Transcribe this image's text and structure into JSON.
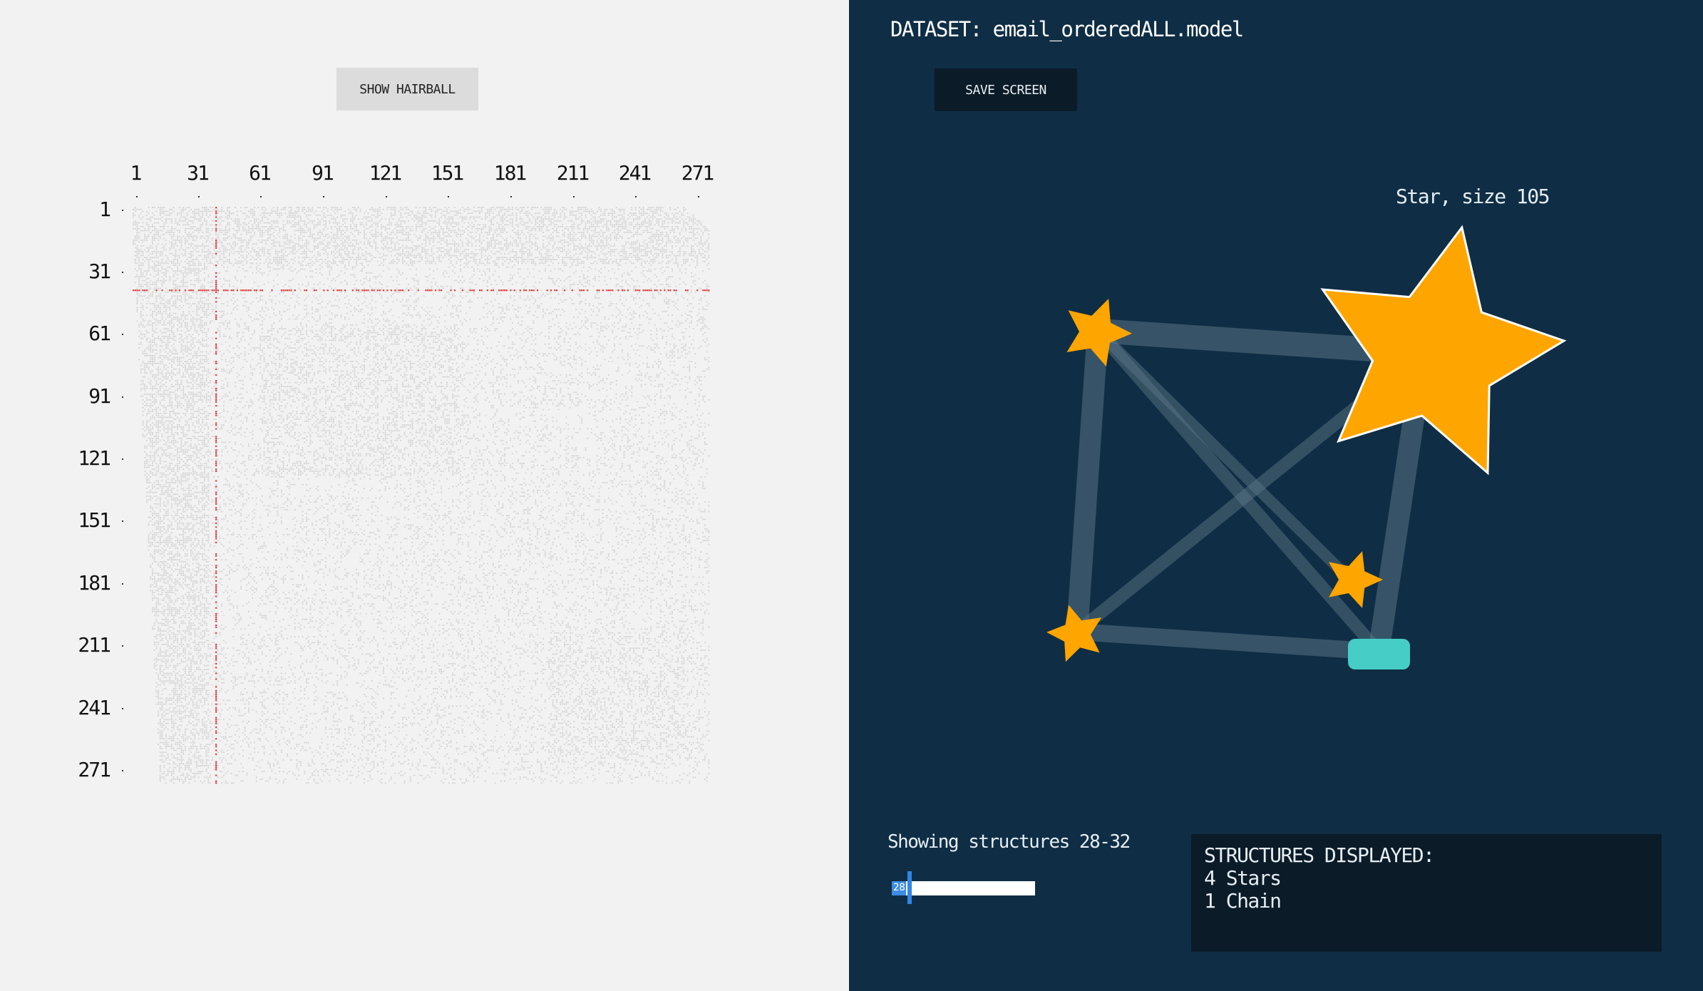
{
  "left_panel": {
    "hairball_button_label": "SHOW HAIRBALL",
    "column_ticks": [
      "1",
      "31",
      "61",
      "91",
      "121",
      "151",
      "181",
      "211",
      "241",
      "271"
    ],
    "row_ticks": [
      "1",
      "31",
      "61",
      "91",
      "121",
      "151",
      "181",
      "211",
      "241",
      "271"
    ],
    "highlight_color": "#e23b3b",
    "matrix_color": "#d6d6d6"
  },
  "right_panel": {
    "dataset_title": "DATASET: email_orderedALL.model",
    "save_button_label": "SAVE SCREEN",
    "hover_label": "Star, size 105",
    "showing_text": "Showing structures 28-32",
    "slider_value": "28",
    "slider_fraction": 0.1,
    "info": {
      "heading": "STRUCTURES DISPLAYED:",
      "line1": "4  Stars",
      "line2": "1 Chain"
    },
    "colors": {
      "background": "#0f2e45",
      "star": "#ffa500",
      "chain": "#46cec6",
      "edge": "#5a7384"
    }
  }
}
